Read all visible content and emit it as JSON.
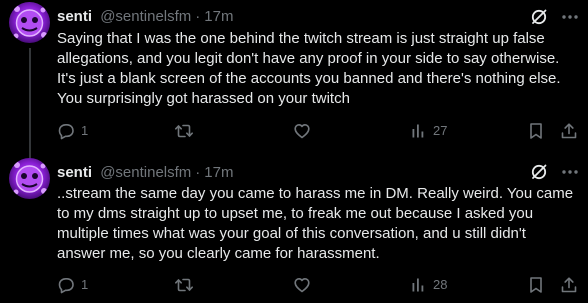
{
  "colors": {
    "background": "#000000",
    "text": "#e7e9ea",
    "secondary": "#71767b",
    "thread_line": "#333639",
    "avatar_primary": "#9b2fe0"
  },
  "posts": [
    {
      "display_name": "senti",
      "handle": "@sentinelsfm",
      "separator": "·",
      "time": "17m",
      "text": "Saying that I was the one behind the twitch stream is just straight up false allegations, and you legit don't have any proof in your side to say otherwise. It's just a blank screen of the accounts you banned and there's nothing else. You surprisingly got harassed on your twitch",
      "reply_count": "1",
      "repost_count": "",
      "like_count": "",
      "view_count": "27",
      "icons": [
        "avatar",
        "grok-icon",
        "more-icon",
        "reply-icon",
        "repost-icon",
        "like-icon",
        "views-icon",
        "bookmark-icon",
        "share-icon"
      ]
    },
    {
      "display_name": "senti",
      "handle": "@sentinelsfm",
      "separator": "·",
      "time": "17m",
      "text": "..stream the same day you came to harass me in DM. Really weird. You came to my dms straight up to upset me, to freak me out because I asked you multiple times what was your goal of this conversation, and  u still didn't answer me, so you clearly came for harassment.",
      "reply_count": "1",
      "repost_count": "",
      "like_count": "",
      "view_count": "28",
      "icons": [
        "avatar",
        "grok-icon",
        "more-icon",
        "reply-icon",
        "repost-icon",
        "like-icon",
        "views-icon",
        "bookmark-icon",
        "share-icon"
      ]
    }
  ]
}
